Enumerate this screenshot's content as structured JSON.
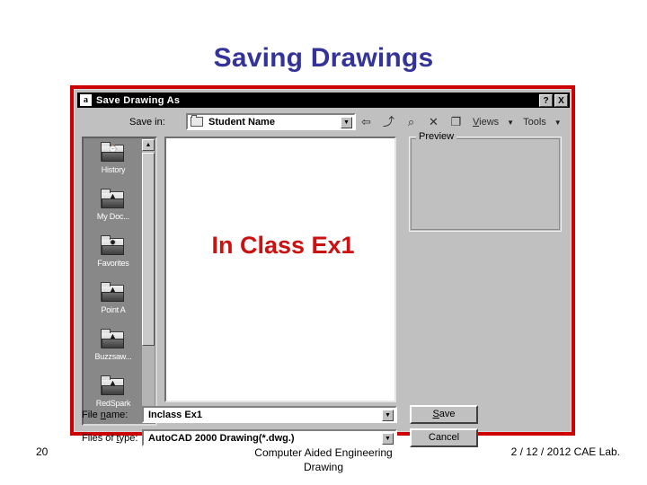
{
  "slide": {
    "title": "Saving Drawings",
    "title_color": "#333399",
    "frame_color": "#cc0000",
    "overlay_text": "In Class Ex1",
    "overlay_color": "#cc1111"
  },
  "dialog": {
    "titlebar": {
      "app_icon": "a",
      "title": "Save Drawing As",
      "help_button": "?",
      "close_button": "X"
    },
    "save_in": {
      "label": "Save in:",
      "value": "Student Name",
      "dropdown_arrow": "▼"
    },
    "toolbar": {
      "icons": [
        {
          "name": "back-arrow-icon",
          "glyph": "⇦"
        },
        {
          "name": "up-one-level-icon",
          "glyph": "⤴"
        },
        {
          "name": "search-web-icon",
          "glyph": "⌕"
        },
        {
          "name": "delete-icon",
          "glyph": "✕"
        },
        {
          "name": "create-new-folder-icon",
          "glyph": "❐"
        }
      ],
      "views_label": "Views",
      "views_caret": "▼",
      "tools_label": "Tools",
      "tools_caret": "▼"
    },
    "places": [
      {
        "label": "History",
        "glyph": "⌚"
      },
      {
        "label": "My Doc...",
        "glyph": "▲"
      },
      {
        "label": "Favorites",
        "glyph": "✹"
      },
      {
        "label": "Point A",
        "glyph": "▲"
      },
      {
        "label": "Buzzsaw...",
        "glyph": "▲"
      },
      {
        "label": "RedSpark",
        "glyph": "▲"
      }
    ],
    "places_scroll": {
      "up_arrow": "▲",
      "down_arrow": "▼"
    },
    "preview": {
      "legend": "Preview"
    },
    "file_name": {
      "label_pre": "File ",
      "label_underlined": "n",
      "label_post": "ame:",
      "value": "Inclass Ex1",
      "dropdown_arrow": "▼"
    },
    "files_of_type": {
      "label_pre": "Files of ",
      "label_underlined": "t",
      "label_post": "ype:",
      "value": "AutoCAD 2000 Drawing(*.dwg.)",
      "dropdown_arrow": "▼"
    },
    "buttons": {
      "save_pre": "",
      "save_underlined": "S",
      "save_post": "ave",
      "cancel": "Cancel"
    }
  },
  "footer": {
    "page_number": "20",
    "center_line1": "Computer Aided Engineering",
    "center_line2": "Drawing",
    "right": "2 / 12 / 2012 CAE Lab."
  }
}
